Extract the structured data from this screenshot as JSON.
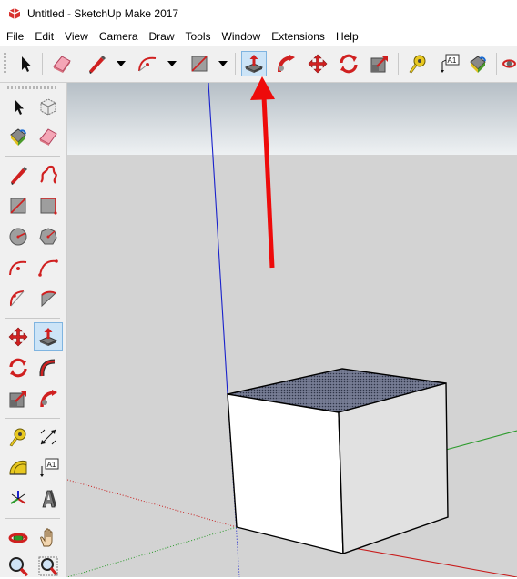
{
  "window": {
    "title": "Untitled - SketchUp Make 2017"
  },
  "menu": [
    "File",
    "Edit",
    "View",
    "Camera",
    "Draw",
    "Tools",
    "Window",
    "Extensions",
    "Help"
  ],
  "toolbar": {
    "items": [
      {
        "icon": "select-arrow-icon"
      },
      {
        "icon": "eraser-icon"
      },
      {
        "icon": "pencil-line-icon"
      },
      {
        "icon": "arc-icon"
      },
      {
        "icon": "rectangle-icon"
      },
      {
        "icon": "push-pull-icon",
        "active": true
      },
      {
        "icon": "follow-me-icon"
      },
      {
        "icon": "move-icon"
      },
      {
        "icon": "rotate-icon"
      },
      {
        "icon": "scale-icon"
      },
      {
        "icon": "tape-measure-icon"
      },
      {
        "icon": "text-label-icon",
        "text": "A1"
      },
      {
        "icon": "paint-bucket-icon"
      }
    ]
  },
  "left_toolbar": {
    "items": [
      "select-arrow-icon",
      "make-component-icon",
      "paint-bucket-icon",
      "eraser-icon",
      "pencil-line-icon",
      "freehand-icon",
      "rectangle-icon",
      "rotated-rectangle-icon",
      "circle-icon",
      "polygon-icon",
      "arc-icon",
      "two-point-arc-icon",
      "three-point-arc-icon",
      "pie-icon",
      "move-icon",
      "push-pull-icon",
      "rotate-icon",
      "follow-me-icon",
      "scale-icon",
      "offset-icon",
      "tape-measure-icon",
      "dimension-icon",
      "protractor-icon",
      "text-label-icon",
      "axes-icon",
      "3d-text-icon",
      "orbit-icon",
      "pan-hand-icon",
      "zoom-icon",
      "zoom-window-icon"
    ],
    "text_label": "A1"
  },
  "annotation": {
    "type": "red-arrow",
    "points_to": "push-pull-button"
  },
  "colors": {
    "sky_top": "#b6bfc6",
    "sky_bottom": "#eef1f3",
    "ground": "#d3d3d3",
    "blue_axis": "#1a22cc",
    "red_axis": "#c81e1e",
    "green_axis": "#2a9a2a",
    "cube_top": "#767c94",
    "cube_front": "#ffffff",
    "cube_side": "#e1e1e1",
    "annotation": "#ee0b0b",
    "active_button": "#cce4f7"
  }
}
